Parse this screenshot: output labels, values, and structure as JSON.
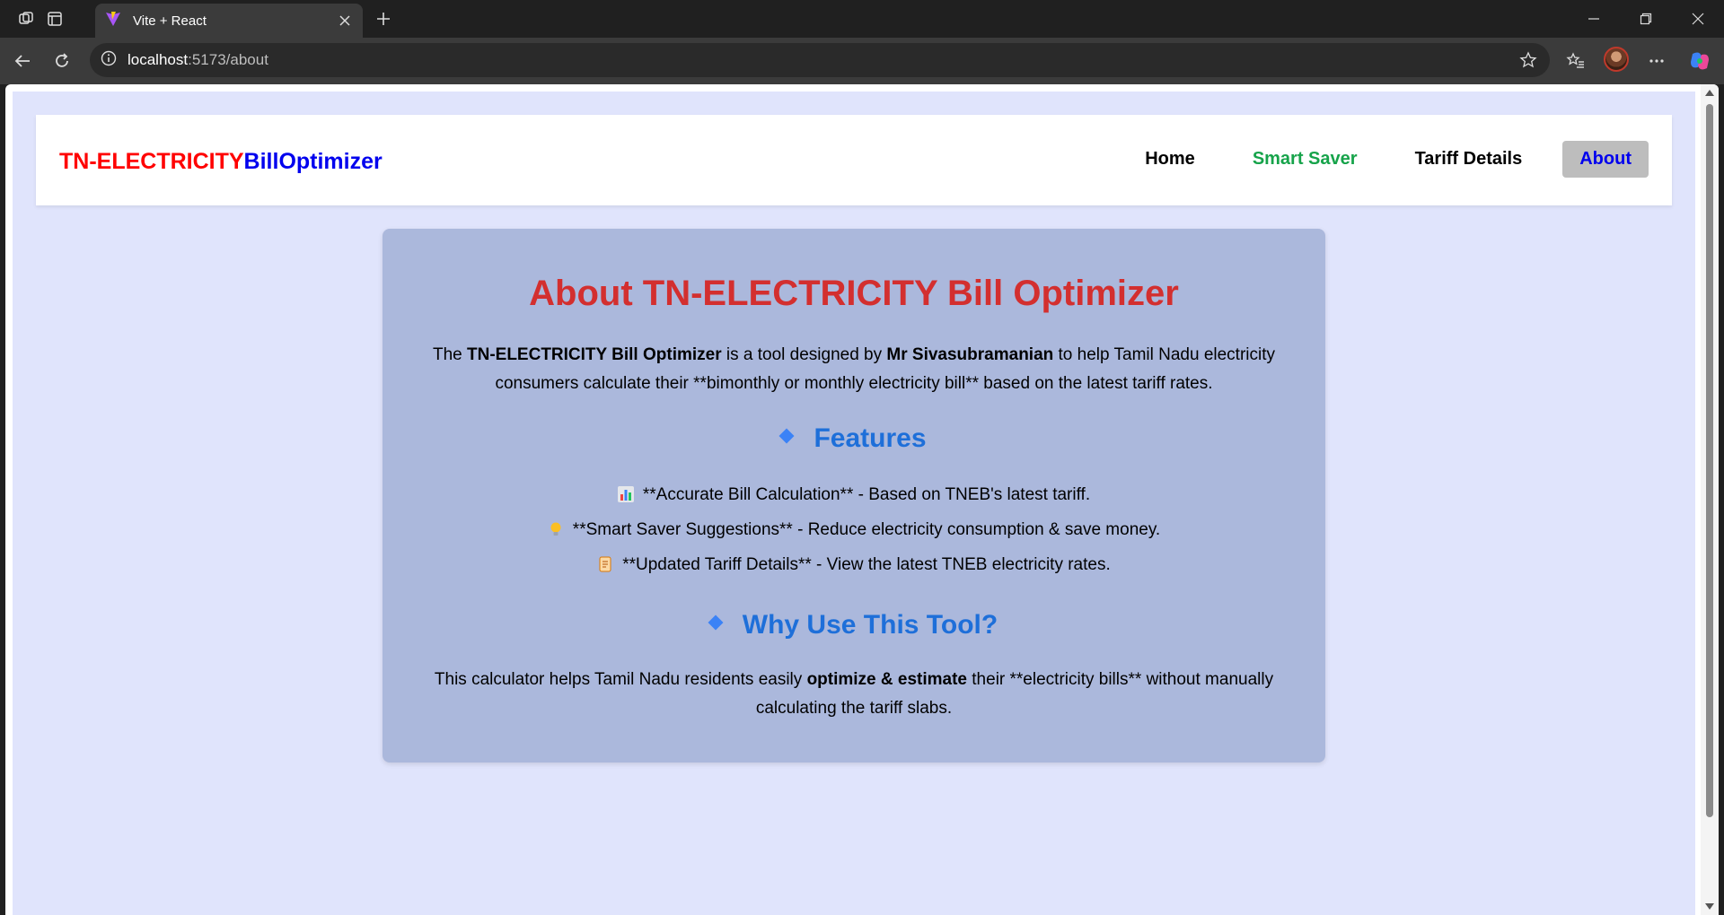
{
  "browser": {
    "tab_title": "Vite + React",
    "url_host": "localhost",
    "url_path": ":5173/about"
  },
  "nav": {
    "brand_part1": "TN-ELECTRICITY",
    "brand_part2": "BillOptimizer",
    "links": [
      "Home",
      "Smart Saver",
      "Tariff Details",
      "About"
    ],
    "active": "About"
  },
  "about": {
    "title": "About TN-ELECTRICITY Bill Optimizer",
    "intro": {
      "t1": "The ",
      "b1": "TN-ELECTRICITY Bill Optimizer",
      "t2": " is a tool designed by ",
      "b2": "Mr Sivasubramanian",
      "t3": " to help Tamil Nadu electricity consumers calculate their **bimonthly or monthly electricity bill** based on the latest tariff rates."
    },
    "features_heading": "Features",
    "features": [
      "**Accurate Bill Calculation** - Based on TNEB's latest tariff.",
      "**Smart Saver Suggestions** - Reduce electricity consumption & save money.",
      "**Updated Tariff Details** - View the latest TNEB electricity rates."
    ],
    "feature_icons": [
      "bar-chart-icon",
      "light-bulb-icon",
      "scroll-icon"
    ],
    "why_heading": "Why Use This Tool?",
    "why": {
      "t1": "This calculator helps Tamil Nadu residents easily ",
      "b1": "optimize & estimate",
      "t2": " their **electricity bills** without manually calculating the tariff slabs."
    }
  },
  "colors": {
    "brand_red": "#ff0000",
    "brand_blue": "#0000ee",
    "smart_saver_green": "#16a34a",
    "title_red": "#d32f2f",
    "heading_blue": "#1e6fd9",
    "card_bg": "#abb8dc",
    "page_bg": "#e0e4fc"
  }
}
